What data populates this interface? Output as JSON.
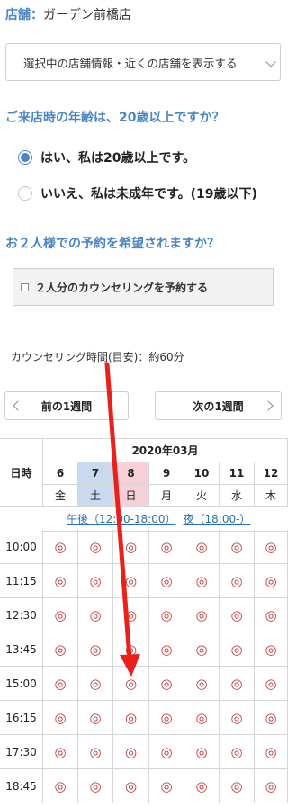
{
  "store": {
    "label": "店舗：",
    "name": "ガーデン前橋店"
  },
  "store_select": {
    "text": "選択中の店舗情報・近くの店舗を表示する"
  },
  "age_question": {
    "title": "ご来店時の年齢は、20歳以上ですか？",
    "options": [
      {
        "label": "はい、私は20歳以上です。",
        "selected": true
      },
      {
        "label": "いいえ、私は未成年です。(19歳以下)",
        "selected": false
      }
    ]
  },
  "pair_question": {
    "title": "お２人様での予約を希望されますか？",
    "checkbox_label": "２人分のカウンセリングを予約する",
    "checked": false
  },
  "counseling_duration": "カウンセリング時間(目安)：約60分",
  "week_nav": {
    "prev": "前の1週間",
    "next": "次の1週間"
  },
  "calendar": {
    "corner_label": "日時",
    "month": "2020年03月",
    "days": [
      {
        "date": "6",
        "weekday": "金",
        "type": "weekday"
      },
      {
        "date": "7",
        "weekday": "土",
        "type": "saturday"
      },
      {
        "date": "8",
        "weekday": "日",
        "type": "sunday"
      },
      {
        "date": "9",
        "weekday": "月",
        "type": "weekday"
      },
      {
        "date": "10",
        "weekday": "火",
        "type": "weekday"
      },
      {
        "date": "11",
        "weekday": "水",
        "type": "weekday"
      },
      {
        "date": "12",
        "weekday": "木",
        "type": "weekday"
      }
    ],
    "filters": {
      "afternoon": "午後（12:00-18:00）",
      "night": "夜（18:00-）"
    },
    "times": [
      "10:00",
      "11:15",
      "12:30",
      "13:45",
      "15:00",
      "16:15",
      "17:30",
      "18:45"
    ],
    "available_symbol": "◎"
  },
  "colors": {
    "accent": "#4a86c5",
    "saturday_bg": "#c9daf0",
    "sunday_bg": "#f6cfd7",
    "slot": "#c0373a",
    "arrow": "#e8211c"
  }
}
